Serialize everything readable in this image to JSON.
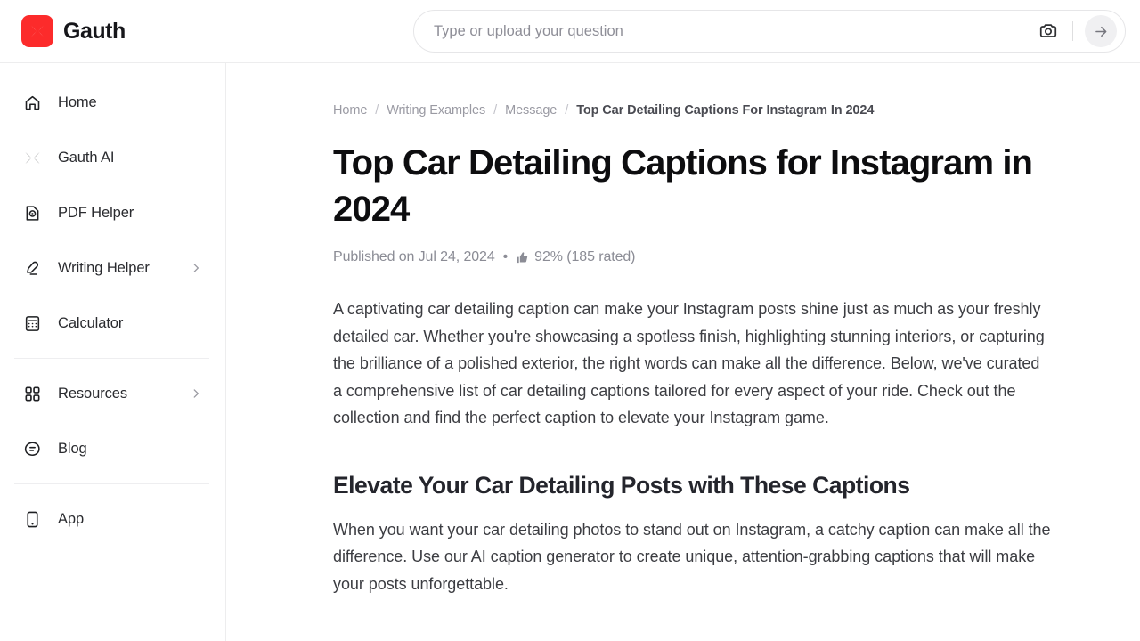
{
  "header": {
    "brand_name": "Gauth",
    "logo_color": "#FC2B2B",
    "logo_icon": "gauth-x-logo-icon",
    "search": {
      "placeholder": "Type or upload your question",
      "value": "",
      "camera_icon": "camera-icon",
      "submit_icon": "arrow-right-icon"
    }
  },
  "sidebar": {
    "groups": [
      {
        "items": [
          {
            "label": "Home",
            "icon": "home-icon",
            "chevron": false
          },
          {
            "label": "Gauth AI",
            "icon": "gauth-ai-icon",
            "chevron": false
          },
          {
            "label": "PDF Helper",
            "icon": "pdf-helper-icon",
            "chevron": false
          },
          {
            "label": "Writing Helper",
            "icon": "pen-icon",
            "chevron": true
          },
          {
            "label": "Calculator",
            "icon": "calculator-icon",
            "chevron": false
          }
        ]
      },
      {
        "items": [
          {
            "label": "Resources",
            "icon": "grid-apps-icon",
            "chevron": true
          },
          {
            "label": "Blog",
            "icon": "blog-icon",
            "chevron": false
          }
        ]
      },
      {
        "items": [
          {
            "label": "App",
            "icon": "mobile-app-icon",
            "chevron": false
          }
        ]
      }
    ]
  },
  "main": {
    "breadcrumb": [
      {
        "label": "Home",
        "current": false
      },
      {
        "label": "Writing Examples",
        "current": false
      },
      {
        "label": "Message",
        "current": false
      },
      {
        "label": "Top Car Detailing Captions For Instagram In 2024",
        "current": true
      }
    ],
    "breadcrumb_separator": "/",
    "title": "Top Car Detailing Captions for Instagram in 2024",
    "meta": {
      "published": "Published on Jul 24, 2024",
      "separator": "•",
      "thumb_icon": "thumbs-up-icon",
      "rating": "92% (185 rated)"
    },
    "intro_paragraph": "A captivating car detailing caption can make your Instagram posts shine just as much as your freshly detailed car. Whether you're showcasing a spotless finish, highlighting stunning interiors, or capturing the brilliance of a polished exterior, the right words can make all the difference. Below, we've curated a comprehensive list of car detailing captions tailored for every aspect of your ride. Check out the collection and find the perfect caption to elevate your Instagram game.",
    "section_heading": "Elevate Your Car Detailing Posts with These Captions",
    "section_paragraph": "When you want your car detailing photos to stand out on Instagram, a catchy caption can make all the difference. Use our AI caption generator to create unique, attention-grabbing captions that will make your posts unforgettable."
  }
}
